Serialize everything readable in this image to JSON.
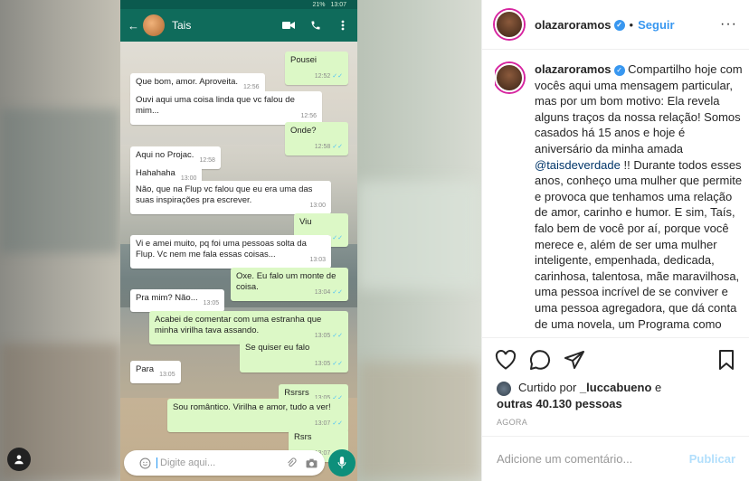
{
  "phone": {
    "status": {
      "battery": "21%",
      "time": "13:07"
    },
    "contact_name": "Tais",
    "messages": [
      {
        "dir": "out",
        "text": "Pousei",
        "time": "12:52",
        "ticks": "✓✓"
      },
      {
        "dir": "in",
        "text": "Que bom, amor. Aproveita.",
        "time": "12:56"
      },
      {
        "dir": "in",
        "text": "Ouvi aqui uma coisa linda que vc falou de mim...",
        "time": "12:56"
      },
      {
        "dir": "out",
        "text": "Onde?",
        "time": "12:58",
        "ticks": "✓✓"
      },
      {
        "dir": "in",
        "text": "Aqui no Projac.",
        "time": "12:58"
      },
      {
        "dir": "in",
        "text": "Hahahaha",
        "time": "13:00"
      },
      {
        "dir": "in",
        "text": "Não, que na Flup vc falou que eu era uma das suas inspirações pra escrever.",
        "time": "13:00"
      },
      {
        "dir": "out",
        "text": "Viu",
        "time": "13:02",
        "ticks": "✓✓"
      },
      {
        "dir": "in",
        "text": "Vi e amei muito, pq foi uma pessoas solta da Flup. Vc nem me fala essas coisas...",
        "time": "13:03"
      },
      {
        "dir": "out",
        "text": "Oxe. Eu falo um monte de coisa.",
        "time": "13:04",
        "ticks": "✓✓"
      },
      {
        "dir": "in",
        "text": "Pra mim? Não...",
        "time": "13:05"
      },
      {
        "dir": "out",
        "text": "Acabei de comentar com uma estranha que minha virilha tava assando.",
        "time": "13:05",
        "ticks": "✓✓"
      },
      {
        "dir": "out",
        "text": "Se quiser eu falo",
        "time": "13:05",
        "ticks": "✓✓"
      },
      {
        "dir": "in",
        "text": "Para",
        "time": "13:05"
      },
      {
        "dir": "out",
        "text": "Rsrsrs",
        "time": "13:05",
        "ticks": "✓✓"
      },
      {
        "dir": "out",
        "text": "Sou romântico.  Virilha e amor, tudo a ver!",
        "time": "13:07",
        "ticks": "✓✓"
      },
      {
        "dir": "out",
        "text": "Rsrs",
        "time": "13:07",
        "ticks": "✓✓"
      }
    ],
    "compose_placeholder": "Digite aqui..."
  },
  "ig": {
    "username": "olazaroramos",
    "follow_label": "Seguir",
    "caption_pre": "Compartilho hoje com vocês aqui uma mensagem particular, mas por um bom motivo: Ela revela alguns traços da nossa relação! Somos casados há 15 anos e hoje é aniversário da minha amada ",
    "mention": "@taisdeverdade",
    "caption_post": " !! Durante todos esses anos, conheço uma mulher que permite e provoca que tenhamos uma relação de amor, carinho e humor. E sim, Taís, falo bem de você por aí, porque você merece e, além de ser uma mulher inteligente, empenhada, dedicada, carinhosa, talentosa, mãe maravilhosa, uma pessoa incrível de se conviver e uma pessoa agregadora, que dá conta de uma novela, um Programa como apresentadora (E faz bem) também das",
    "liked_by_prefix": "Curtido por ",
    "liked_by_user": "_luccabueno",
    "liked_by_join": " e",
    "liked_others": "outras 40.130 pessoas",
    "timestamp": "AGORA",
    "comment_placeholder": "Adicione um comentário...",
    "publish_label": "Publicar",
    "more_label": "···"
  },
  "colors": {
    "wa_header": "#0f6b5b",
    "wa_out": "#dcf8c6",
    "ig_blue": "#3897f0"
  },
  "icons": [
    "user-icon",
    "video-call-icon",
    "phone-icon",
    "more-vert-icon",
    "emoji-icon",
    "attach-icon",
    "camera-icon",
    "mic-icon",
    "heart-icon",
    "comment-icon",
    "share-icon",
    "bookmark-icon",
    "verified-icon"
  ]
}
